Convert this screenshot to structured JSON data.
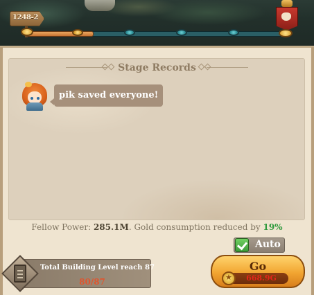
{
  "stage": {
    "label": "1248-2",
    "progress_fraction": 0.25
  },
  "progress_nodes": [
    {
      "state": "done"
    },
    {
      "state": "pending"
    },
    {
      "state": "pending"
    },
    {
      "state": "pending"
    }
  ],
  "records": {
    "title": "Stage Records",
    "messages": [
      {
        "text": "pik saved everyone!"
      }
    ]
  },
  "fellow": {
    "prefix": "Fellow Power: ",
    "power": "285.1M",
    "middle": ". Gold consumption reduced by ",
    "reduction": "19%"
  },
  "auto": {
    "label": "Auto",
    "checked": true
  },
  "quest": {
    "text": "Total Building Level reach 87",
    "progress": "80/87"
  },
  "go": {
    "label": "Go",
    "cost": "668.9G"
  },
  "colors": {
    "accent_green": "#2f9a3d",
    "cost_red": "#e2261a",
    "go_orange": "#f1a531"
  }
}
